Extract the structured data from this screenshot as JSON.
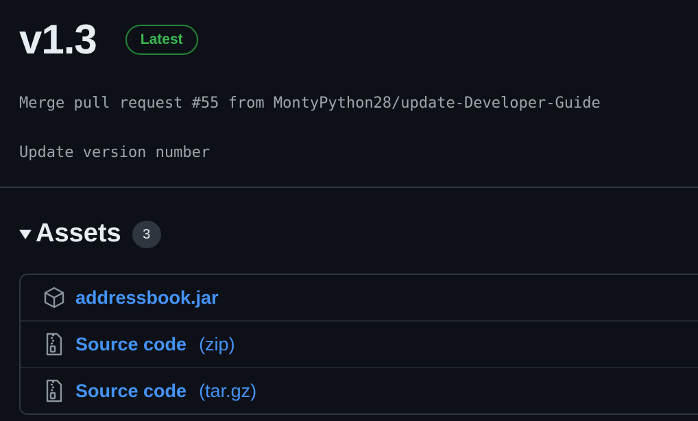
{
  "release": {
    "version": "v1.3",
    "badge": "Latest",
    "notes": [
      "Merge pull request #55 from MontyPython28/update-Developer-Guide",
      "Update version number"
    ]
  },
  "assets": {
    "title": "Assets",
    "count": "3",
    "items": [
      {
        "icon": "package-icon",
        "name": "addressbook.jar",
        "suffix": ""
      },
      {
        "icon": "file-zip-icon",
        "name": "Source code",
        "suffix": "(zip)"
      },
      {
        "icon": "file-zip-icon",
        "name": "Source code",
        "suffix": "(tar.gz)"
      }
    ]
  },
  "colors": {
    "background": "#0d1117",
    "link": "#4493f8",
    "latest_badge": "#3fb950",
    "border": "#30363d"
  }
}
